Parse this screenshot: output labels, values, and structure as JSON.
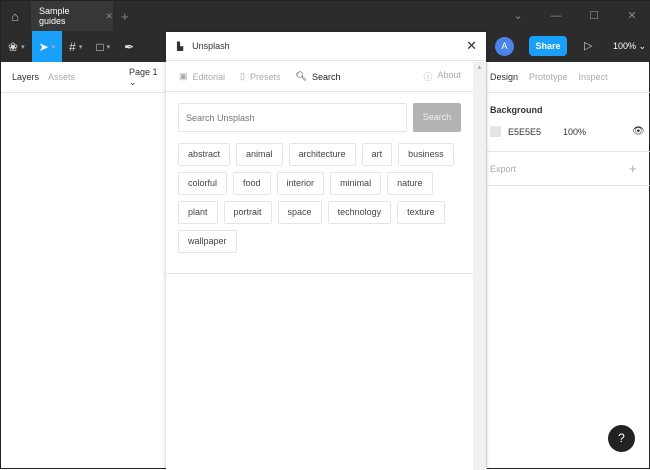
{
  "titlebar": {
    "tab": "Sample guides"
  },
  "toolbar": {
    "avatar": "A",
    "share": "Share",
    "zoom": "100%"
  },
  "left_panel": {
    "layers": "Layers",
    "assets": "Assets",
    "page": "Page 1"
  },
  "right_panel": {
    "tabs": [
      "Design",
      "Prototype",
      "Inspect"
    ],
    "background_label": "Background",
    "color": "E5E5E5",
    "opacity": "100%",
    "export": "Export"
  },
  "plugin": {
    "title": "Unsplash",
    "tabs": [
      "Editorial",
      "Presets",
      "Search"
    ],
    "about": "About",
    "search_placeholder": "Search Unsplash",
    "search_button": "Search",
    "tags": [
      "abstract",
      "animal",
      "architecture",
      "art",
      "business",
      "colorful",
      "food",
      "interior",
      "minimal",
      "nature",
      "plant",
      "portrait",
      "space",
      "technology",
      "texture",
      "wallpaper"
    ]
  },
  "help": "?"
}
